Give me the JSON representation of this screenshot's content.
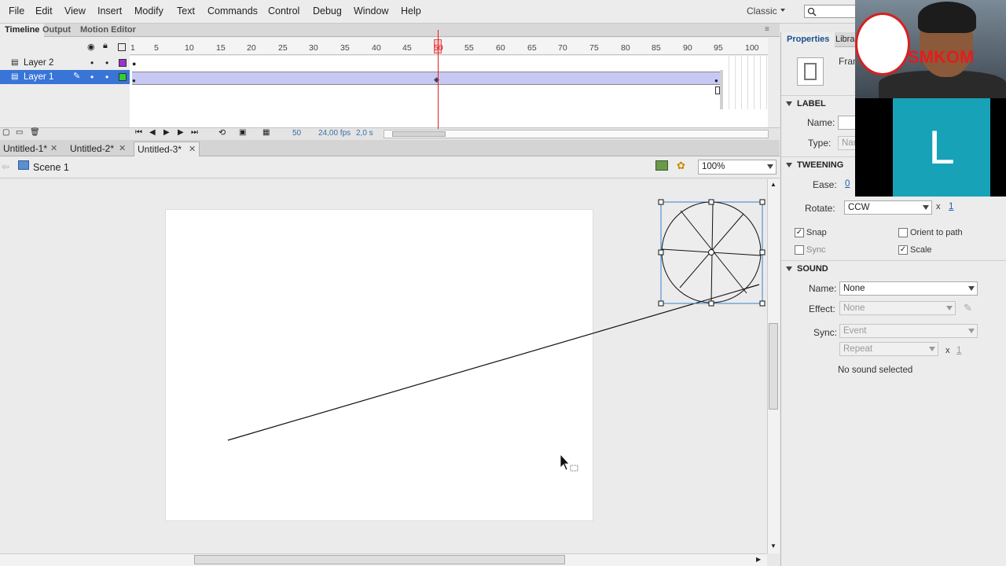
{
  "menu": {
    "items": [
      "File",
      "Edit",
      "View",
      "Insert",
      "Modify",
      "Text",
      "Commands",
      "Control",
      "Debug",
      "Window",
      "Help"
    ],
    "workspace": "Classic"
  },
  "timeline": {
    "tabs": [
      "Timeline",
      "Output",
      "Motion Editor"
    ],
    "ruler_ticks": [
      "1",
      "5",
      "10",
      "15",
      "20",
      "25",
      "30",
      "35",
      "40",
      "45",
      "50",
      "55",
      "60",
      "65",
      "70",
      "75",
      "80",
      "85",
      "90",
      "95",
      "100"
    ],
    "layers": [
      {
        "name": "Layer 2",
        "color": "#9933cc"
      },
      {
        "name": "Layer 1",
        "color": "#33cc33"
      }
    ],
    "current_frame": "50",
    "fps": "24,00 fps",
    "time": "2,0 s"
  },
  "document_tabs": [
    {
      "label": "Untitled-1*"
    },
    {
      "label": "Untitled-2*"
    },
    {
      "label": "Untitled-3*"
    }
  ],
  "editbar": {
    "scene": "Scene 1",
    "zoom": "100%"
  },
  "properties": {
    "tabs": [
      "Properties",
      "Library"
    ],
    "frame_label": "Frame",
    "label_section": "LABEL",
    "name_label": "Name:",
    "type_label": "Type:",
    "type_value": "Name",
    "tweening_section": "TWEENING",
    "ease_label": "Ease:",
    "ease_value": "0",
    "rotate_label": "Rotate:",
    "rotate_value": "CCW",
    "rotate_times_prefix": "x",
    "rotate_times": "1",
    "snap_label": "Snap",
    "orient_label": "Orient to path",
    "sync_label": "Sync",
    "scale_label": "Scale",
    "sound_section": "SOUND",
    "sound_name_label": "Name:",
    "sound_name_value": "None",
    "effect_label": "Effect:",
    "effect_value": "None",
    "sync2_label": "Sync:",
    "sync2_value": "Event",
    "repeat_value": "Repeat",
    "repeat_times_prefix": "x",
    "repeat_times": "1",
    "no_sound": "No sound selected"
  },
  "overlay": {
    "logo_text": "SMKOM",
    "letter": "L"
  }
}
